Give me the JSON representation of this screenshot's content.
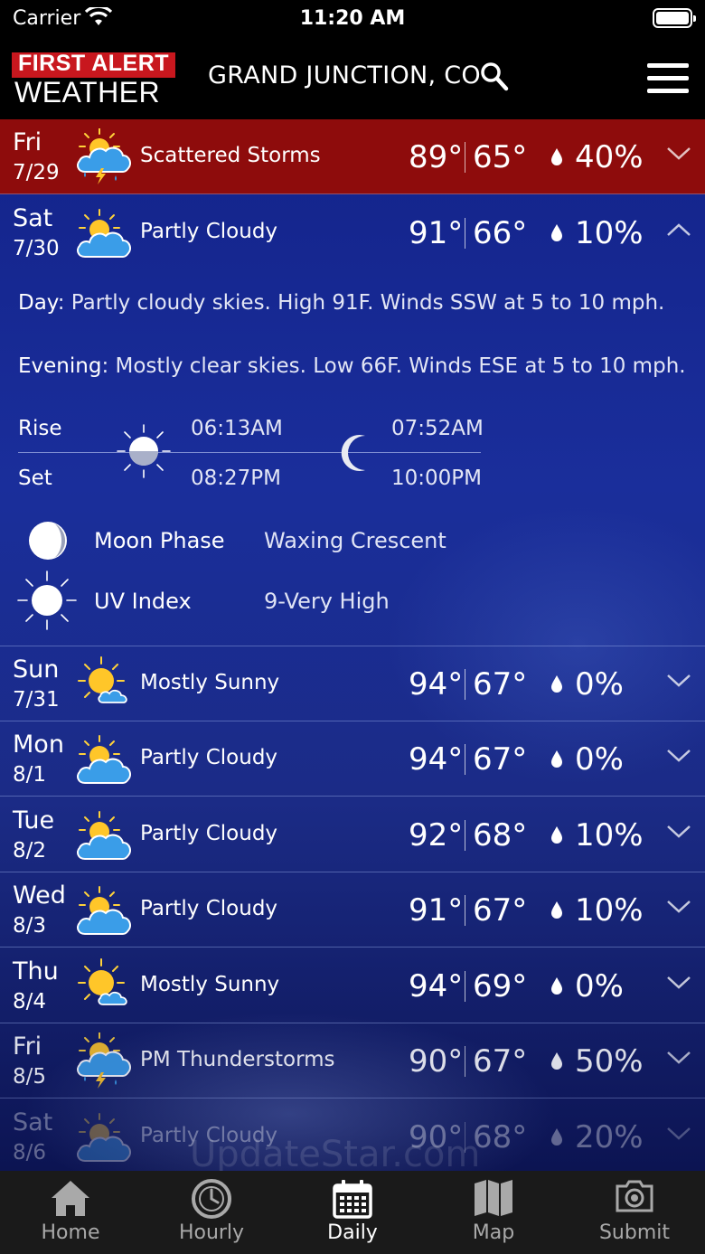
{
  "status_bar": {
    "carrier": "Carrier",
    "time": "11:20 AM"
  },
  "header": {
    "logo_line1": "FIRST ALERT",
    "logo_line2": "WEATHER",
    "location": "GRAND JUNCTION, CO"
  },
  "days": [
    {
      "dow": "Fri",
      "date": "7/29",
      "icon": "storm-icon",
      "condition": "Scattered Storms",
      "high": "89°",
      "low": "65°",
      "precip": "40%"
    },
    {
      "dow": "Sat",
      "date": "7/30",
      "icon": "partly-cloudy-icon",
      "condition": "Partly Cloudy",
      "high": "91°",
      "low": "66°",
      "precip": "10%"
    },
    {
      "dow": "Sun",
      "date": "7/31",
      "icon": "mostly-sunny-icon",
      "condition": "Mostly Sunny",
      "high": "94°",
      "low": "67°",
      "precip": "0%"
    },
    {
      "dow": "Mon",
      "date": "8/1",
      "icon": "partly-cloudy-icon",
      "condition": "Partly Cloudy",
      "high": "94°",
      "low": "67°",
      "precip": "0%"
    },
    {
      "dow": "Tue",
      "date": "8/2",
      "icon": "partly-cloudy-icon",
      "condition": "Partly Cloudy",
      "high": "92°",
      "low": "68°",
      "precip": "10%"
    },
    {
      "dow": "Wed",
      "date": "8/3",
      "icon": "partly-cloudy-icon",
      "condition": "Partly Cloudy",
      "high": "91°",
      "low": "67°",
      "precip": "10%"
    },
    {
      "dow": "Thu",
      "date": "8/4",
      "icon": "mostly-sunny-icon",
      "condition": "Mostly Sunny",
      "high": "94°",
      "low": "69°",
      "precip": "0%"
    },
    {
      "dow": "Fri",
      "date": "8/5",
      "icon": "storm-icon",
      "condition": "PM Thunderstorms",
      "high": "90°",
      "low": "67°",
      "precip": "50%"
    },
    {
      "dow": "Sat",
      "date": "8/6",
      "icon": "partly-cloudy-icon",
      "condition": "Partly Cloudy",
      "high": "90°",
      "low": "68°",
      "precip": "20%"
    }
  ],
  "expanded": {
    "day_label": "Day",
    "day_text": ": Partly cloudy skies. High 91F. Winds SSW at 5 to 10 mph.",
    "evening_label": "Evening",
    "evening_text": ": Mostly clear skies. Low 66F. Winds ESE at 5 to 10 mph.",
    "rise_label": "Rise",
    "set_label": "Set",
    "sunrise": "06:13AM",
    "sunset": "08:27PM",
    "moonrise": "07:52AM",
    "moonset": "10:00PM",
    "moon_phase_label": "Moon Phase",
    "moon_phase_value": "Waxing Crescent",
    "uv_label": "UV Index",
    "uv_value": "9-Very High"
  },
  "watermark": "UpdateStar.com",
  "tabs": [
    {
      "label": "Home",
      "icon": "home-icon"
    },
    {
      "label": "Hourly",
      "icon": "clock-icon"
    },
    {
      "label": "Daily",
      "icon": "calendar-icon",
      "active": true
    },
    {
      "label": "Map",
      "icon": "map-icon"
    },
    {
      "label": "Submit",
      "icon": "camera-icon"
    }
  ],
  "colors": {
    "header_bg": "#000000",
    "selected_row": "#8e0c0c",
    "content_bg": "#1a2e9b",
    "tabbar_bg": "#1a1a1a"
  }
}
